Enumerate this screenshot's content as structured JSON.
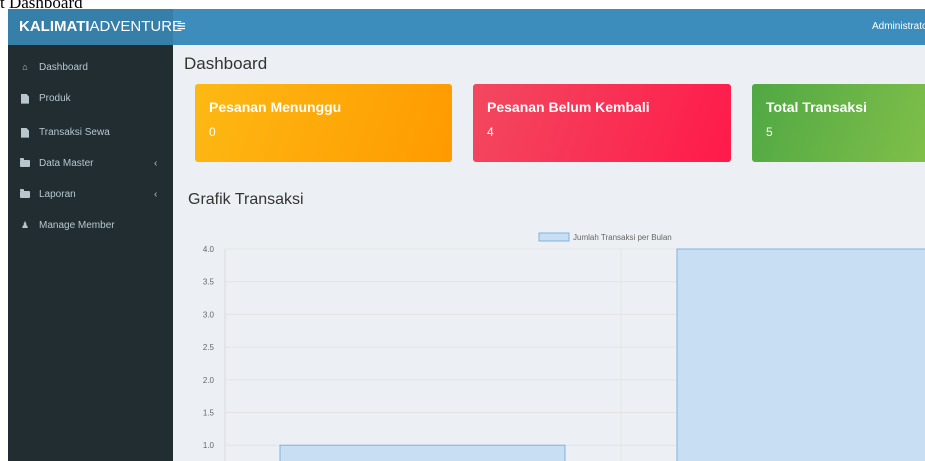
{
  "browser_tab_title": "t Dashboard",
  "header": {
    "logo_bold": "KALIMATI",
    "logo_rest": "ADVENTURE",
    "menu_icon": "bars-icon",
    "user_label": "Administrato"
  },
  "sidebar": {
    "items": [
      {
        "label": "Dashboard",
        "icon": "home-icon",
        "caret": ""
      },
      {
        "label": "Produk",
        "icon": "file-icon",
        "caret": ""
      },
      {
        "label": "Transaksi Sewa",
        "icon": "file-icon",
        "caret": ""
      },
      {
        "label": "Data Master",
        "icon": "folder-icon",
        "caret": "‹"
      },
      {
        "label": "Laporan",
        "icon": "folder-icon",
        "caret": "‹"
      },
      {
        "label": "Manage Member",
        "icon": "users-icon",
        "caret": ""
      }
    ]
  },
  "main": {
    "page_title": "Dashboard",
    "cards": [
      {
        "title": "Pesanan Menunggu",
        "value": "0",
        "color": "#ff9f00"
      },
      {
        "title": "Pesanan Belum Kembali",
        "value": "4",
        "color": "#fb2d50"
      },
      {
        "title": "Total Transaksi",
        "value": "5",
        "color": "#6cb845"
      }
    ],
    "chart_section_title": "Grafik Transaksi"
  },
  "colors": {
    "header": "#3c8dbc",
    "logo_bg": "#367fa9",
    "sidebar": "#222d32",
    "content_bg": "#ecf0f5",
    "bar_fill": "#c7def3",
    "bar_border": "#7fb3e0"
  },
  "chart_data": {
    "type": "bar",
    "categories": [
      "",
      ""
    ],
    "series": [
      {
        "name": "Jumlah Transaksi per Bulan",
        "values": [
          1,
          4
        ]
      }
    ],
    "y_ticks": [
      "4.0",
      "3.5",
      "3.0",
      "2.5",
      "2.0",
      "1.5",
      "1.0"
    ],
    "ylim": [
      1.0,
      4.0
    ],
    "legend": "top-center",
    "grid": true
  }
}
